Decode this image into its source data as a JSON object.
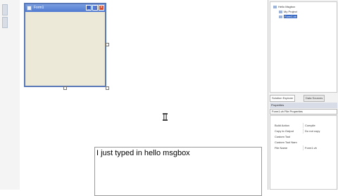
{
  "form": {
    "title": "Form1"
  },
  "note": {
    "text": "I just typed in hello msgbox"
  },
  "solution_explorer": {
    "items": [
      {
        "label": "Hello Msgbox",
        "level": 0
      },
      {
        "label": "My Project",
        "level": 1
      },
      {
        "label": "Form1.vb",
        "level": 1,
        "selected": true
      }
    ]
  },
  "tabs": {
    "solution_explorer": "Solution Explorer",
    "data_sources": "Data Sources"
  },
  "properties": {
    "header": "Properties",
    "object": "Form1.vb File Properties",
    "rows": [
      {
        "name": "Build Action",
        "value": "Compile"
      },
      {
        "name": "Copy to Output",
        "value": "Do not copy"
      },
      {
        "name": "Custom Tool",
        "value": ""
      },
      {
        "name": "Custom Tool Nam",
        "value": ""
      },
      {
        "name": "File Name",
        "value": "Form1.vb"
      }
    ]
  }
}
